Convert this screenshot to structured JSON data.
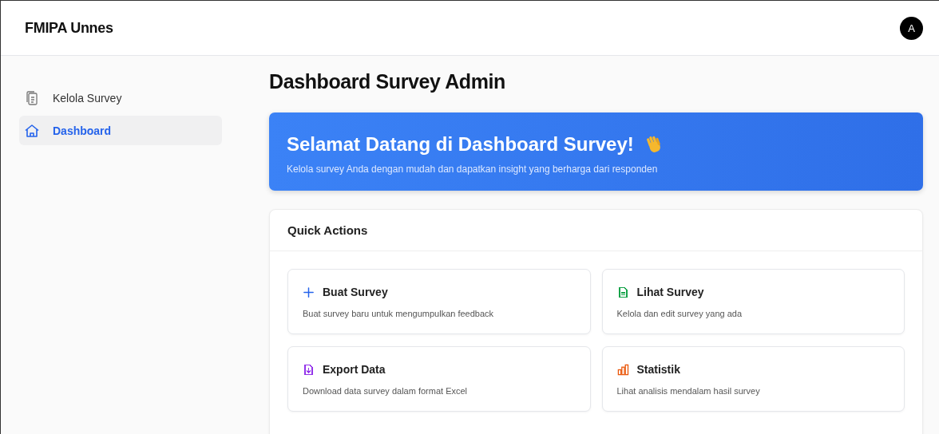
{
  "header": {
    "brand": "FMIPA Unnes",
    "avatar": "A"
  },
  "sidebar": {
    "items": [
      {
        "label": "Kelola Survey",
        "kind": "clipboard",
        "selected": false
      },
      {
        "label": "Dashboard",
        "kind": "home",
        "selected": true
      }
    ]
  },
  "page_title": "Dashboard Survey Admin",
  "banner": {
    "title": "Selamat Datang di Dashboard Survey!",
    "subtitle": "Kelola survey Anda dengan mudah dan dapatkan insight yang berharga dari responden"
  },
  "quick_actions": {
    "title": "Quick Actions",
    "actions": [
      {
        "kind": "plus",
        "color": "#2563eb",
        "title": "Buat Survey",
        "description": "Buat survey baru untuk mengumpulkan feedback"
      },
      {
        "kind": "file",
        "color": "#16a34a",
        "title": "Lihat Survey",
        "description": "Kelola dan edit survey yang ada"
      },
      {
        "kind": "download",
        "color": "#9333ea",
        "title": "Export Data",
        "description": "Download data survey dalam format Excel"
      },
      {
        "kind": "chart",
        "color": "#ea580c",
        "title": "Statistik",
        "description": "Lihat analisis mendalam hasil survey"
      }
    ]
  }
}
